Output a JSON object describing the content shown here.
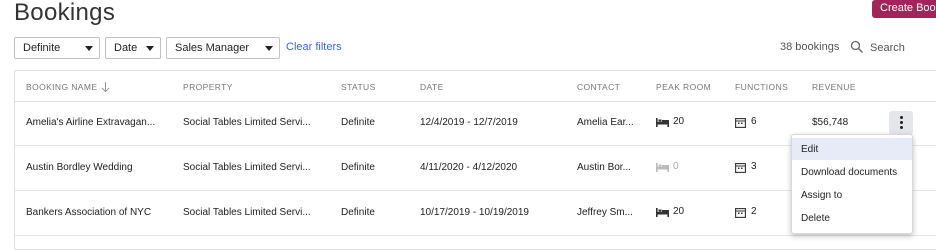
{
  "page": {
    "title": "Bookings"
  },
  "header": {
    "create_button": "Create Booking"
  },
  "filters": {
    "status": "Definite",
    "date": "Date",
    "role": "Sales Manager",
    "clear": "Clear filters"
  },
  "search": {
    "count": "38 bookings",
    "placeholder": "Search"
  },
  "table": {
    "columns": [
      "BOOKING NAME",
      "PROPERTY",
      "STATUS",
      "DATE",
      "CONTACT",
      "PEAK ROOM",
      "FUNCTIONS",
      "REVENUE"
    ],
    "rows": [
      {
        "name": "Amelia's Airline Extravagan...",
        "property": "Social Tables Limited Servi...",
        "status": "Definite",
        "date": "12/4/2019 - 12/7/2019",
        "contact": "Amelia Ear...",
        "peak": "20",
        "functions": "6",
        "revenue": "$56,748"
      },
      {
        "name": "Austin Bordley Wedding",
        "property": "Social Tables Limited Servi...",
        "status": "Definite",
        "date": "4/11/2020 - 4/12/2020",
        "contact": "Austin Bor...",
        "peak": "0",
        "functions": "3",
        "revenue": ""
      },
      {
        "name": "Bankers Association of NYC",
        "property": "Social Tables Limited Servi...",
        "status": "Definite",
        "date": "10/17/2019 - 10/19/2019",
        "contact": "Jeffrey Sm...",
        "peak": "20",
        "functions": "2",
        "revenue": ""
      }
    ]
  },
  "menu": {
    "items": [
      "Edit",
      "Download documents",
      "Assign to",
      "Delete"
    ]
  },
  "colors": {
    "brand": "#a3245b",
    "link": "#3b6bc9",
    "menu_highlight": "#e6ebf7"
  }
}
